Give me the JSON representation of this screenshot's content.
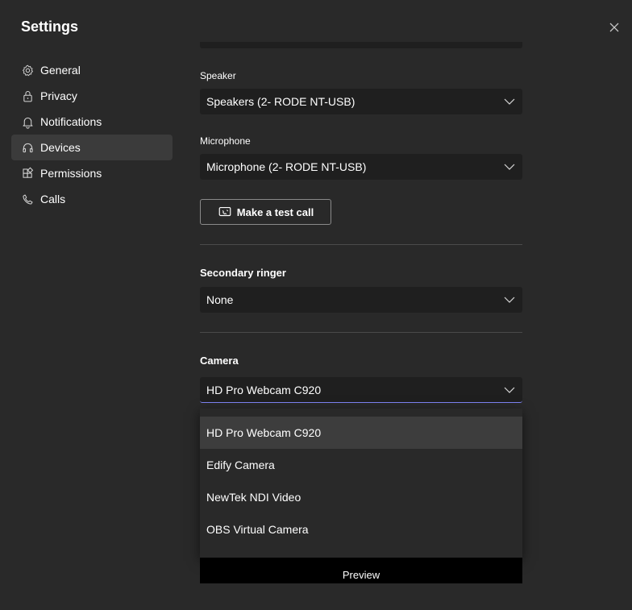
{
  "window": {
    "title": "Settings"
  },
  "nav": {
    "items": [
      {
        "label": "General",
        "icon": "gear-icon"
      },
      {
        "label": "Privacy",
        "icon": "lock-icon"
      },
      {
        "label": "Notifications",
        "icon": "bell-icon"
      },
      {
        "label": "Devices",
        "icon": "headset-icon",
        "active": true
      },
      {
        "label": "Permissions",
        "icon": "apps-icon"
      },
      {
        "label": "Calls",
        "icon": "phone-icon"
      }
    ]
  },
  "devices": {
    "speaker": {
      "label": "Speaker",
      "value": "Speakers (2- RODE NT-USB)"
    },
    "microphone": {
      "label": "Microphone",
      "value": "Microphone (2- RODE NT-USB)"
    },
    "test_call_label": "Make a test call",
    "secondary_ringer": {
      "label": "Secondary ringer",
      "value": "None"
    },
    "camera": {
      "label": "Camera",
      "value": "HD Pro Webcam C920",
      "options": [
        "HD Pro Webcam C920",
        "Edify Camera",
        "NewTek NDI Video",
        "OBS Virtual Camera"
      ]
    },
    "preview_label": "Preview"
  },
  "colors": {
    "background": "#292929",
    "field": "#1f1f1f",
    "accent": "#7f85f5",
    "nav_active": "#3b3b3b"
  }
}
